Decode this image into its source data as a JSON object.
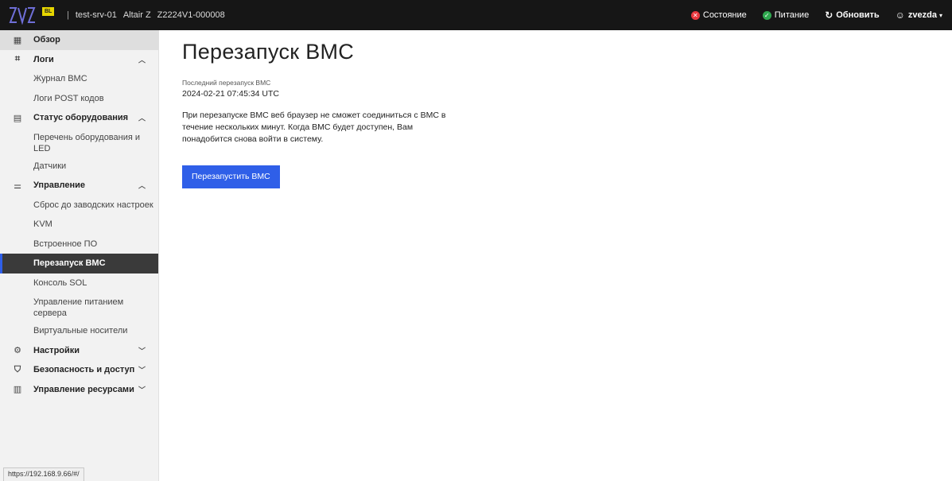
{
  "header": {
    "logo_badge": "BL",
    "separator": "|",
    "hostname": "test-srv-01",
    "model": "Altair Z",
    "serial": "Z2224V1-000008",
    "status_label": "Состояние",
    "power_label": "Питание",
    "refresh_label": "Обновить",
    "user_label": "zvezda",
    "status_color": "#e8373e",
    "power_color": "#2fa84f"
  },
  "sidebar": {
    "overview": "Обзор",
    "logs": "Логи",
    "logs_items": [
      "Журнал BMC",
      "Логи POST кодов"
    ],
    "hardware": "Статус оборудования",
    "hardware_items": [
      "Перечень оборудования и LED",
      "Датчики"
    ],
    "control": "Управление",
    "control_items": [
      "Сброс до заводских настроек",
      "KVM",
      "Встроенное ПО",
      "Перезапуск BMC",
      "Консоль SOL",
      "Управление питанием сервера",
      "Виртуальные носители"
    ],
    "settings": "Настройки",
    "security": "Безопасность и доступ",
    "resources": "Управление ресурсами"
  },
  "status_url": "https://192.168.9.66/#/",
  "main": {
    "title": "Перезапуск BMC",
    "last_reboot_label": "Последний перезапуск BMC",
    "last_reboot_value": "2024-02-21 07:45:34 UTC",
    "description": "При перезапуске BMC веб браузер не сможет соединиться с BMC в течение нескольких минут. Когда BMC будет доступен, Вам понадобится снова войти в систему.",
    "reboot_button": "Перезапустить BMC"
  }
}
